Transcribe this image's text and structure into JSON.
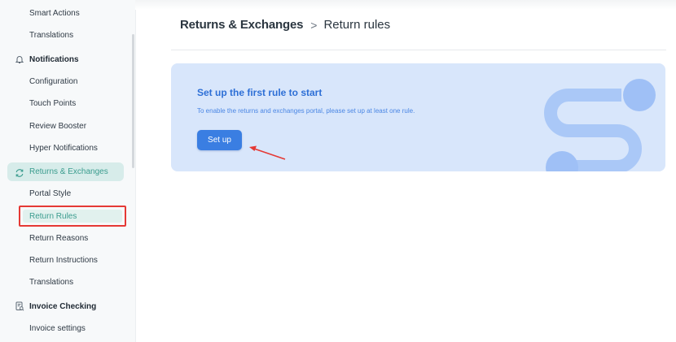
{
  "sidebar": {
    "items": [
      {
        "label": "Smart Actions"
      },
      {
        "label": "Translations"
      },
      {
        "label": "Notifications",
        "type": "section",
        "icon": "bell-icon"
      },
      {
        "label": "Configuration"
      },
      {
        "label": "Touch Points"
      },
      {
        "label": "Review Booster"
      },
      {
        "label": "Hyper Notifications"
      },
      {
        "label": "Returns & Exchanges",
        "type": "section",
        "icon": "sync-icon",
        "active": true
      },
      {
        "label": "Portal Style"
      },
      {
        "label": "Return Rules",
        "selected": true
      },
      {
        "label": "Return Reasons"
      },
      {
        "label": "Return Instructions"
      },
      {
        "label": "Translations"
      },
      {
        "label": "Invoice Checking",
        "type": "section",
        "icon": "invoice-check-icon"
      },
      {
        "label": "Invoice settings"
      }
    ]
  },
  "breadcrumb": {
    "parent": "Returns & Exchanges",
    "separator": ">",
    "current": "Return rules"
  },
  "card": {
    "title": "Set up the first rule to start",
    "description": "To enable the returns and exchanges portal, please set up at least one rule.",
    "button_label": "Set up"
  },
  "colors": {
    "accent_teal": "#3a9c8e",
    "active_bg": "#d7ecea",
    "card_bg": "#d8e6fb",
    "primary_blue": "#3a7ee2",
    "highlight_red": "#e53935"
  }
}
